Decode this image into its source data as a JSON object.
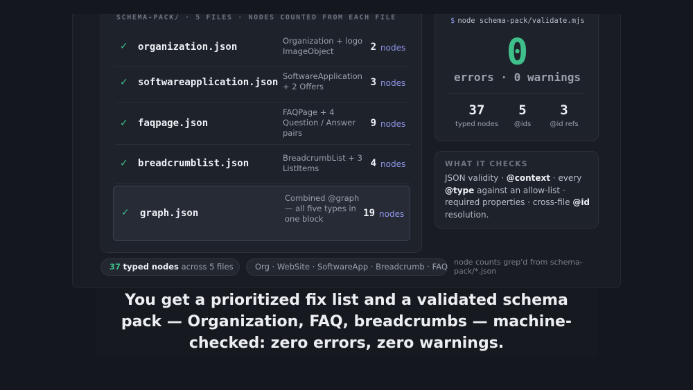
{
  "files": {
    "header": "SCHEMA-PACK/  ·  5 FILES  ·  NODES COUNTED FROM EACH FILE",
    "unit": "nodes",
    "rows": [
      {
        "name": "organization.json",
        "desc": "Organization + logo ImageObject",
        "count": "2"
      },
      {
        "name": "softwareapplication.json",
        "desc": "SoftwareApplication + 2 Offers",
        "count": "3"
      },
      {
        "name": "faqpage.json",
        "desc": "FAQPage + 4 Question / Answer pairs",
        "count": "9"
      },
      {
        "name": "breadcrumblist.json",
        "desc": "BreadcrumbList + 3 ListItems",
        "count": "4"
      },
      {
        "name": "graph.json",
        "desc": "Combined @graph — all five types in one block",
        "count": "19"
      }
    ]
  },
  "terminal": {
    "prompt": "$",
    "command": "node schema-pack/validate.mjs",
    "errors_value": "0",
    "errors_line": "errors · 0 warnings",
    "stats": [
      {
        "value": "37",
        "label": "typed nodes"
      },
      {
        "value": "5",
        "label": "@ids"
      },
      {
        "value": "3",
        "label": "@id refs"
      }
    ]
  },
  "checks": {
    "title": "WHAT IT CHECKS",
    "t1": "JSON validity · ",
    "b1": "@context",
    "t2": " · every ",
    "b2": "@type",
    "t3": " against an allow-list · required properties · cross-file ",
    "b3": "@id",
    "t4": " resolution."
  },
  "pills": {
    "summary_num": "37",
    "summary_bold": "typed nodes",
    "summary_rest": "across 5 files",
    "types": "Org · WebSite · SoftwareApp · Breadcrumb · FAQ"
  },
  "footnote": "node counts grep'd from schema-pack/*.json",
  "caption": "You get a prioritized fix list and a validated schema pack — Organization, FAQ, breadcrumbs — machine-checked: zero errors, zero warnings.",
  "colors": {
    "accent_green": "#3fbf8a",
    "accent_purple": "#8f96e8",
    "background": "#14171d"
  },
  "icons": {
    "check": "check-icon"
  }
}
